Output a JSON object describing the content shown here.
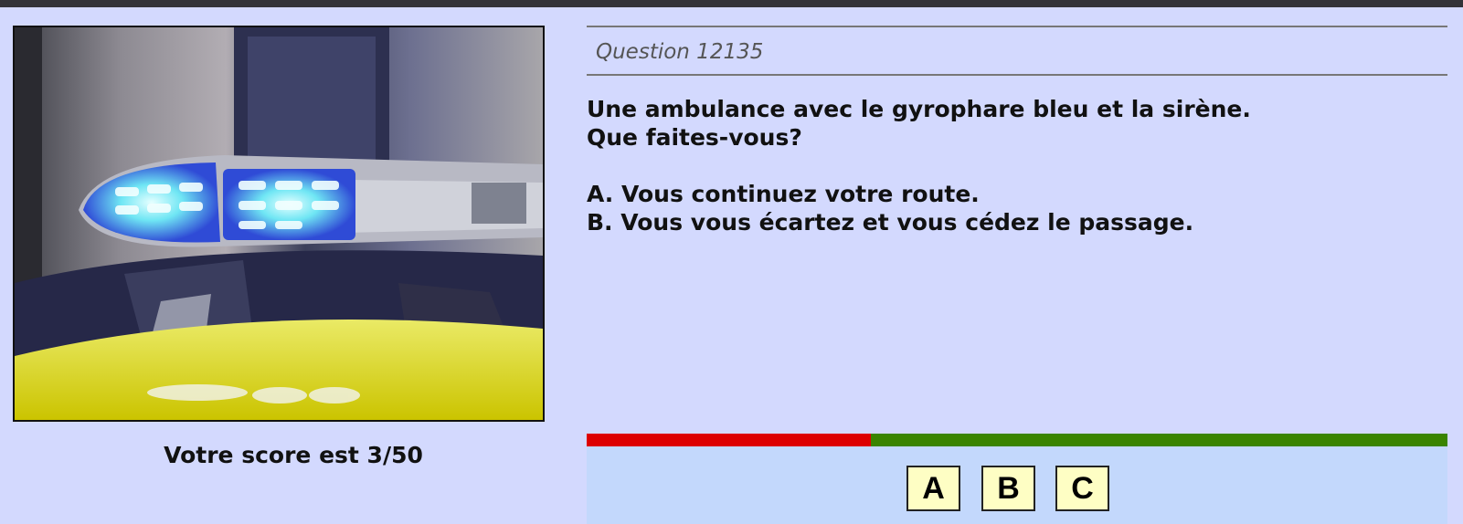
{
  "question": {
    "number_label": "Question 12135",
    "lines": [
      "Une ambulance avec le gyrophare bleu et la sirène.",
      "Que faites-vous?"
    ],
    "options": [
      "A. Vous continuez votre route.",
      "B. Vous vous écartez et vous cédez le passage."
    ]
  },
  "score": {
    "text": "Votre score est 3/50",
    "correct": 3,
    "total": 50
  },
  "progress": {
    "fraction_incorrect": 0.33,
    "incorrect_color": "#dd0000",
    "correct_color": "#3a8400"
  },
  "answer_buttons": [
    "A",
    "B",
    "C"
  ],
  "colors": {
    "page_background": "#d3d9fe",
    "answer_panel": "#c3d8fc",
    "button_background": "#fefec4"
  },
  "photo": {
    "icon": "blue-emergency-light-photo"
  }
}
